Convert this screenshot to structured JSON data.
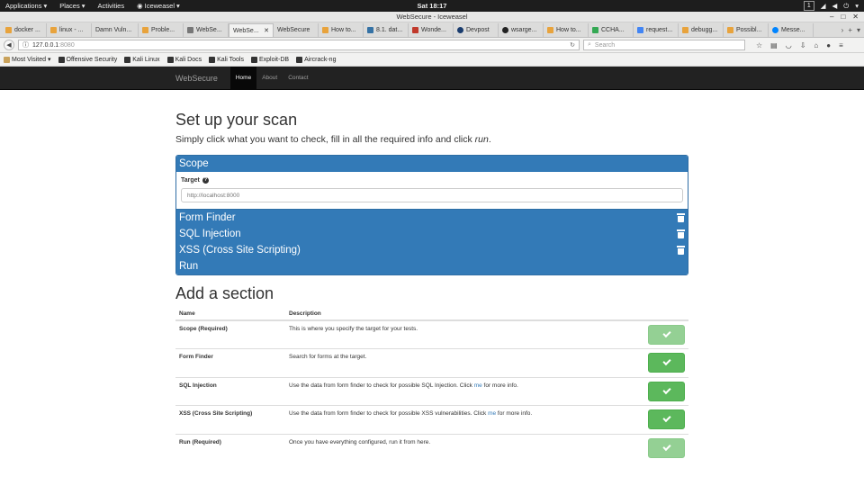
{
  "gnome": {
    "applications": "Applications",
    "places": "Places",
    "activities": "Activities",
    "app_name": "Iceweasel",
    "clock": "Sat 18:17",
    "workspace": "1"
  },
  "window": {
    "title": "WebSecure - Iceweasel"
  },
  "tabs": [
    {
      "label": "docker ..."
    },
    {
      "label": "linux - ..."
    },
    {
      "label": "Damn Vuln..."
    },
    {
      "label": "Proble..."
    },
    {
      "label": "WebSe..."
    },
    {
      "label": "WebSe..."
    },
    {
      "label": "WebSecure"
    },
    {
      "label": "How to..."
    },
    {
      "label": "8.1. dat..."
    },
    {
      "label": "Wonde..."
    },
    {
      "label": "Devpost"
    },
    {
      "label": "wsarge..."
    },
    {
      "label": "How to..."
    },
    {
      "label": "CCHA..."
    },
    {
      "label": "request..."
    },
    {
      "label": "debugg..."
    },
    {
      "label": "Possibl..."
    },
    {
      "label": "Messe..."
    }
  ],
  "nav": {
    "url_host": "127.0.0.1",
    "url_port": ":8080",
    "search_placeholder": "Search"
  },
  "bookmarks": [
    {
      "label": "Most Visited"
    },
    {
      "label": "Offensive Security"
    },
    {
      "label": "Kali Linux"
    },
    {
      "label": "Kali Docs"
    },
    {
      "label": "Kali Tools"
    },
    {
      "label": "Exploit-DB"
    },
    {
      "label": "Aircrack-ng"
    }
  ],
  "app": {
    "brand": "WebSecure",
    "links": [
      "Home",
      "About",
      "Contact"
    ]
  },
  "page": {
    "title": "Set up your scan",
    "lead_text": "Simply click what you want to check, fill in all the required info and click ",
    "lead_em": "run",
    "lead_end": "."
  },
  "scan": {
    "scope_label": "Scope",
    "target_label": "Target",
    "target_placeholder": "http://localhost:8000",
    "sections": [
      "Form Finder",
      "SQL Injection",
      "XSS (Cross Site Scripting)"
    ],
    "run_label": "Run"
  },
  "add_section": {
    "title": "Add a section",
    "col_name": "Name",
    "col_desc": "Description",
    "rows": [
      {
        "name": "Scope (Required)",
        "desc": "This is where you specify the target for your tests.",
        "link": "",
        "desc_end": ""
      },
      {
        "name": "Form Finder",
        "desc": "Search for forms at the target.",
        "link": "",
        "desc_end": ""
      },
      {
        "name": "SQL Injection",
        "desc": "Use the data from form finder to check for possible SQL Injection. Click ",
        "link": "me",
        "desc_end": " for more info."
      },
      {
        "name": "XSS (Cross Site Scripting)",
        "desc": "Use the data from form finder to check for possible XSS vulnerabilities. Click ",
        "link": "me",
        "desc_end": " for more info."
      },
      {
        "name": "Run (Required)",
        "desc": "Once you have everything configured, run it from here.",
        "link": "",
        "desc_end": ""
      }
    ]
  },
  "colors": {
    "primary": "#337ab7",
    "success": "#5cb85c",
    "navbar": "#222222"
  }
}
